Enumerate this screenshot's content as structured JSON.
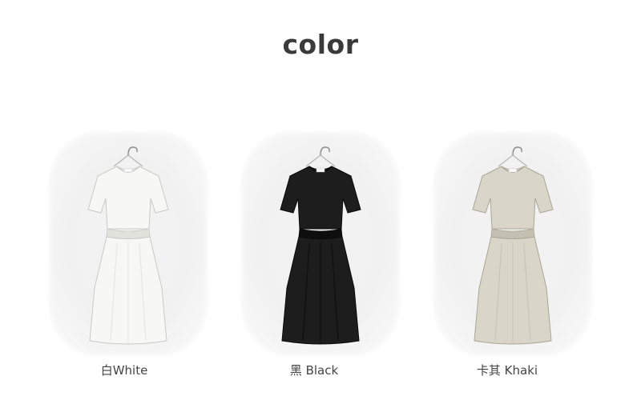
{
  "heading": "color",
  "colors": [
    {
      "label": "白White",
      "fill": "#f7f7f5",
      "shade": "#e2e2dd",
      "stroke": "#c9c9c4"
    },
    {
      "label": "黑 Black",
      "fill": "#1d1d1d",
      "shade": "#0e0e0e",
      "stroke": "#0a0a0a"
    },
    {
      "label": "卡其 Khaki",
      "fill": "#d9d6c9",
      "shade": "#c4c0b1",
      "stroke": "#aaa696"
    }
  ]
}
